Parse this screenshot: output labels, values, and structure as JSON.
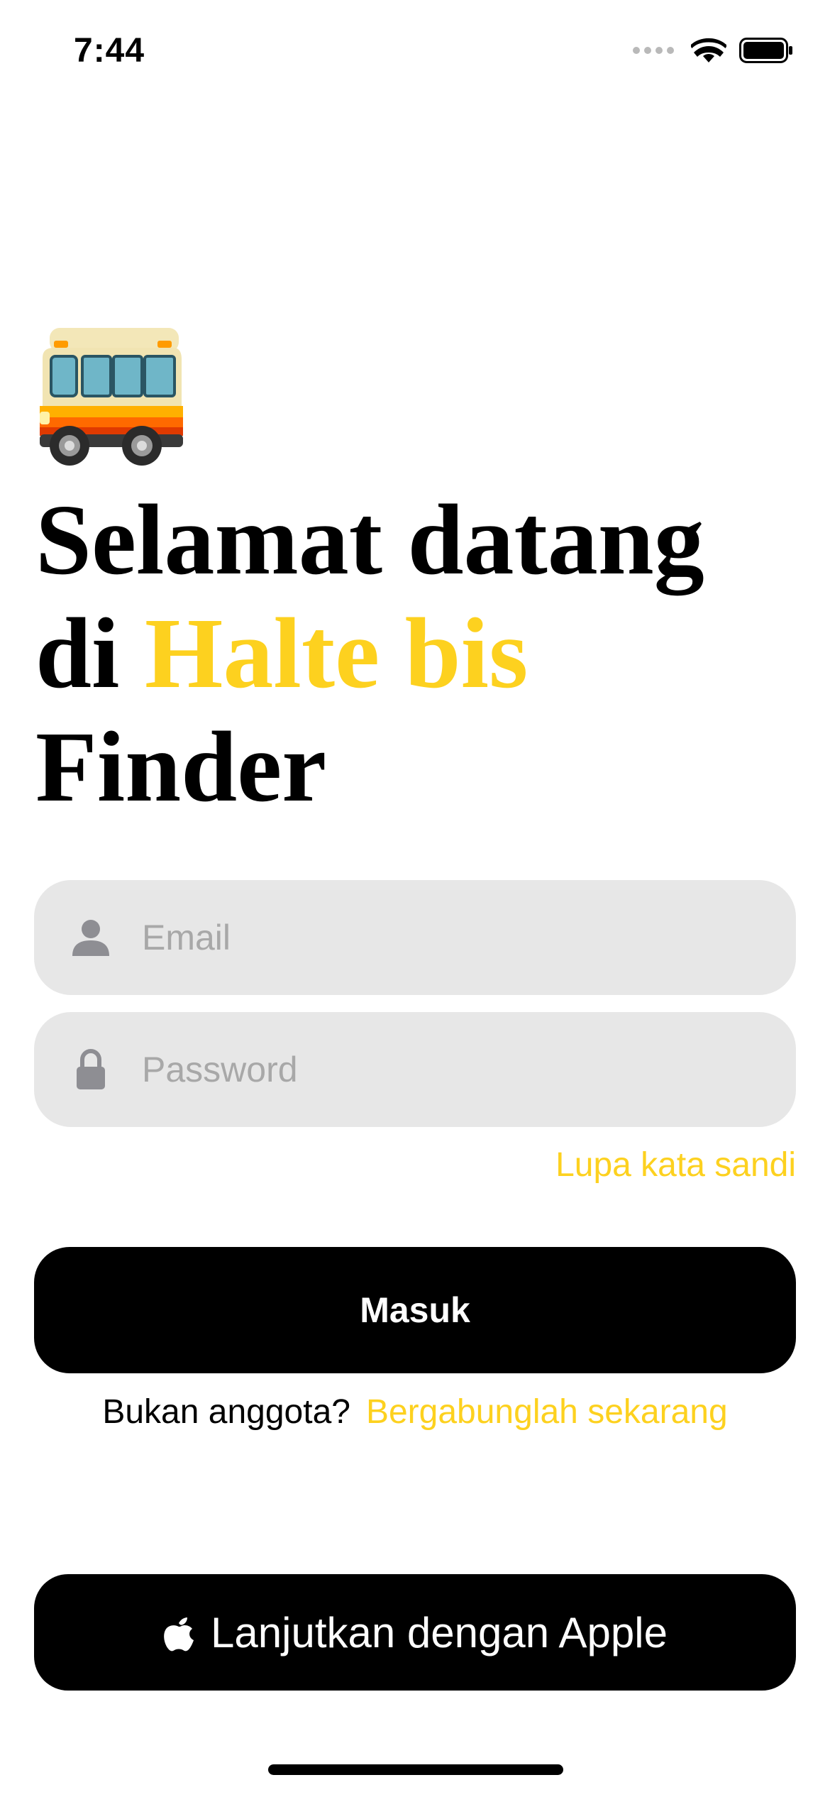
{
  "status_bar": {
    "time": "7:44",
    "icons": [
      "signal-dots-icon",
      "wifi-icon",
      "battery-icon"
    ]
  },
  "hero": {
    "icon": "bus-emoji-icon",
    "headline_line1": "Selamat datang",
    "headline_di": "di ",
    "headline_accent": "Halte bis",
    "headline_line3": "Finder"
  },
  "form": {
    "email": {
      "icon": "person-icon",
      "value": "",
      "placeholder": "Email"
    },
    "password": {
      "icon": "lock-icon",
      "value": "",
      "placeholder": "Password"
    },
    "forgot_label": "Lupa kata sandi",
    "submit_label": "Masuk",
    "signup_prompt": "Bukan anggota?",
    "signup_link": "Bergabunglah sekarang"
  },
  "apple_signin": {
    "icon": "apple-logo-icon",
    "label": "Lanjutkan dengan Apple"
  },
  "colors": {
    "accent": "#FDD11F",
    "field_background": "#E7E7E7",
    "button_background": "#000000",
    "placeholder": "#A8A8A8"
  }
}
